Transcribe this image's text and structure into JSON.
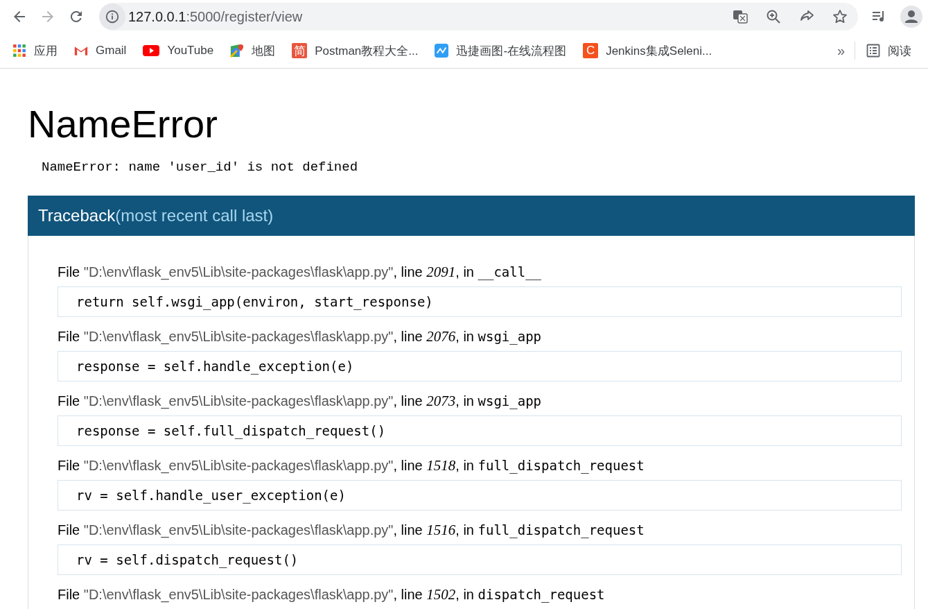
{
  "browser": {
    "url_host": "127.0.0.1",
    "url_path": ":5000/register/view",
    "bookmarks": [
      {
        "kind": "apps",
        "label": "应用"
      },
      {
        "kind": "gmail",
        "label": "Gmail"
      },
      {
        "kind": "youtube",
        "label": "YouTube"
      },
      {
        "kind": "maps",
        "label": "地图"
      },
      {
        "kind": "letter",
        "glyph": "简",
        "color": "#e8553e",
        "label": "Postman教程大全..."
      },
      {
        "kind": "chart",
        "label": "迅捷画图-在线流程图"
      },
      {
        "kind": "letter",
        "glyph": "C",
        "color": "#f4511e",
        "label": "Jenkins集成Seleni..."
      }
    ],
    "overflow": "»",
    "reading_list": "阅读"
  },
  "page": {
    "title": "NameError",
    "message": "NameError: name 'user_id' is not defined",
    "traceback_title": "Traceback",
    "traceback_note": "(most recent call last)",
    "frames": [
      {
        "file_label": "File ",
        "path": "\"D:\\env\\flask_env5\\Lib\\site-packages\\flask\\app.py\"",
        "line_label": ", line ",
        "line": "2091",
        "in_label": ", in ",
        "function": "__call__",
        "code": "return self.wsgi_app(environ, start_response)"
      },
      {
        "file_label": "File ",
        "path": "\"D:\\env\\flask_env5\\Lib\\site-packages\\flask\\app.py\"",
        "line_label": ", line ",
        "line": "2076",
        "in_label": ", in ",
        "function": "wsgi_app",
        "code": "response = self.handle_exception(e)"
      },
      {
        "file_label": "File ",
        "path": "\"D:\\env\\flask_env5\\Lib\\site-packages\\flask\\app.py\"",
        "line_label": ", line ",
        "line": "2073",
        "in_label": ", in ",
        "function": "wsgi_app",
        "code": "response = self.full_dispatch_request()"
      },
      {
        "file_label": "File ",
        "path": "\"D:\\env\\flask_env5\\Lib\\site-packages\\flask\\app.py\"",
        "line_label": ", line ",
        "line": "1518",
        "in_label": ", in ",
        "function": "full_dispatch_request",
        "code": "rv = self.handle_user_exception(e)"
      },
      {
        "file_label": "File ",
        "path": "\"D:\\env\\flask_env5\\Lib\\site-packages\\flask\\app.py\"",
        "line_label": ", line ",
        "line": "1516",
        "in_label": ", in ",
        "function": "full_dispatch_request",
        "code": "rv = self.dispatch_request()"
      },
      {
        "file_label": "File ",
        "path": "\"D:\\env\\flask_env5\\Lib\\site-packages\\flask\\app.py\"",
        "line_label": ", line ",
        "line": "1502",
        "in_label": ", in ",
        "function": "dispatch_request"
      }
    ]
  }
}
